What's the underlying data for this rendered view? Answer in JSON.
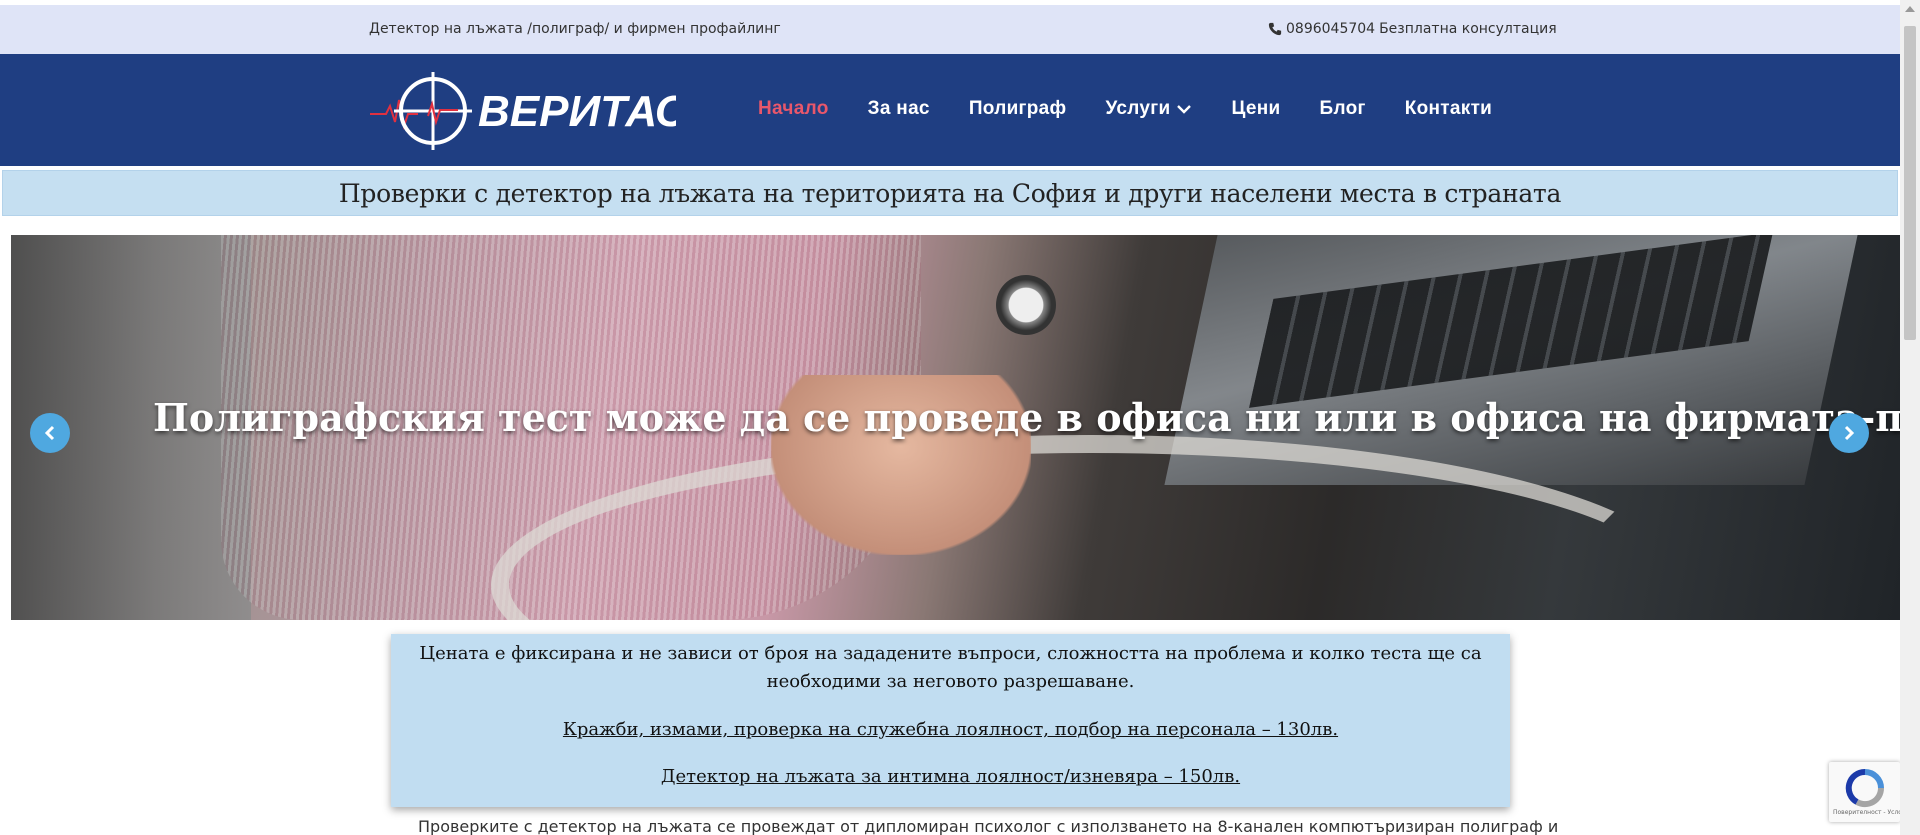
{
  "topbar": {
    "tagline": "Детектор на лъжата /полиграф/ и фирмен профайлинг",
    "phone": "0896045704",
    "consultation": "Безплатна консултация"
  },
  "header": {
    "logo_text": "ВЕРИТАС+",
    "nav": [
      {
        "label": "Начало",
        "active": true
      },
      {
        "label": "За нас"
      },
      {
        "label": "Полиграф"
      },
      {
        "label": "Услуги",
        "has_dropdown": true
      },
      {
        "label": "Цени"
      },
      {
        "label": "Блог"
      },
      {
        "label": "Контакти"
      }
    ]
  },
  "banner": {
    "text": "Проверки с детектор на лъжата на територията на София и други населени места в страната"
  },
  "slider": {
    "caption": "Полиграфския тест може да се проведе в офиса ни или в офиса на фирмата-поръчител"
  },
  "pricing": {
    "intro": "Цената е фиксирана и не зависи от броя на зададените въпроси, сложността на проблема и колко теста ще са необходими за неговото разрешаване.",
    "line1": "Кражби, измами, проверка на служебна лоялност, подбор на персонала – 130лв.",
    "line2": "Детектор на лъжата за интимна лоялност/изневяра –  150лв."
  },
  "body": {
    "paragraph_start": "Проверките с детектор на лъжата се провеждат от дипломиран психолог с използването на 8-канален компютъризиран полиграф и"
  },
  "recaptcha": {
    "text": "Поверителност - Условия"
  },
  "colors": {
    "header_bg": "#1f3e82",
    "topbar_bg": "#dfe4f7",
    "banner_bg": "#c5dff1",
    "nav_active": "#e8576b",
    "arrow_bg": "#4fa8e0"
  }
}
